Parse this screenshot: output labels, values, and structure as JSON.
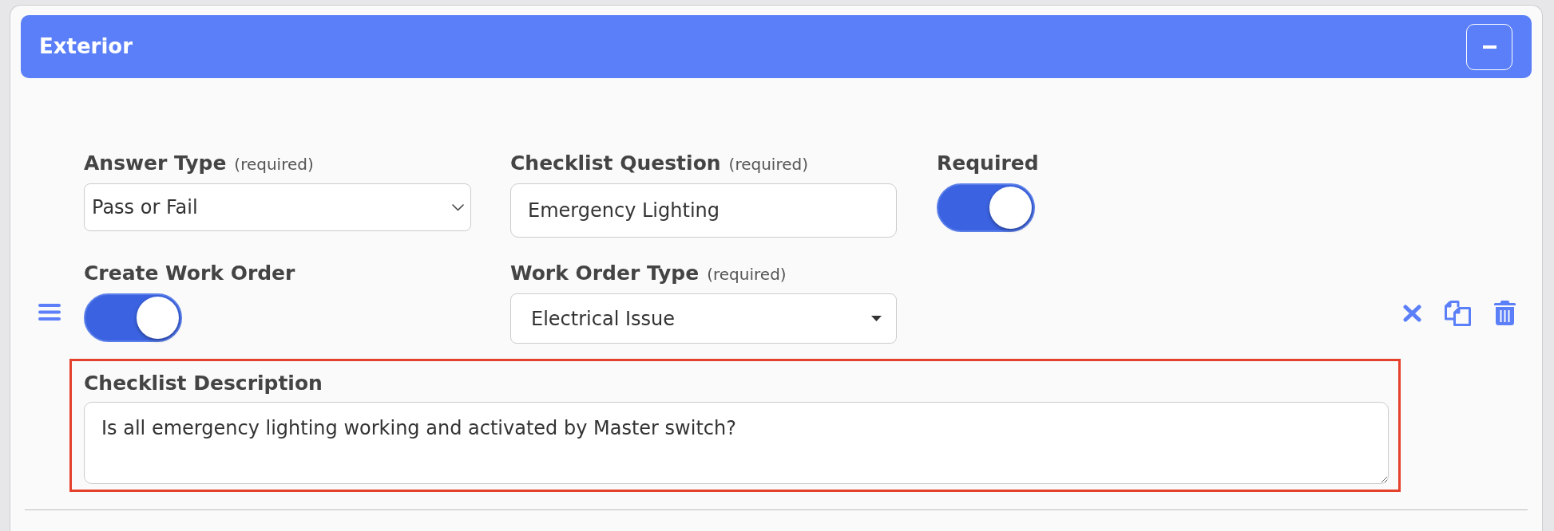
{
  "section": {
    "title": "Exterior",
    "expanded": true
  },
  "rows": [
    {
      "fields": [
        {
          "kind": "select",
          "label": "Answer Type",
          "note": "(required)",
          "value": "Pass or Fail"
        },
        {
          "kind": "text",
          "label": "Checklist Question",
          "note": "(required)",
          "value": "Emergency Lighting"
        },
        {
          "kind": "toggle",
          "label": "Required",
          "on": true
        }
      ]
    },
    {
      "fields": [
        {
          "kind": "toggle",
          "label": "Create Work Order",
          "on": true
        },
        {
          "kind": "dropdown",
          "label": "Work Order Type",
          "note": "(required)",
          "value": "Electrical Issue"
        }
      ]
    }
  ],
  "description": {
    "label": "Checklist Description",
    "value": "Is all emergency lighting working and activated by Master switch?",
    "highlighted": true
  }
}
